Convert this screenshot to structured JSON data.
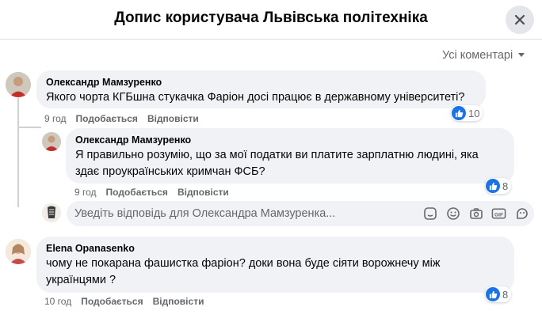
{
  "header": {
    "title": "Допис користувача Львівська політехніка"
  },
  "sort": {
    "label": "Усі коментарі"
  },
  "comments": [
    {
      "author": "Олександр Мамзуренко",
      "text": "Якого чорта КГБшна стукачка Фаріон досі працює в державному університеті?",
      "time": "9 год",
      "like": "Подобається",
      "reply": "Відповісти",
      "reactions": "10",
      "replies": [
        {
          "author": "Олександр Мамзуренко",
          "text": "Я правильно розумію, що за мої податки ви платите зарплатню людині, яка здає проукраїнських кримчан ФСБ?",
          "time": "9 год",
          "like": "Подобається",
          "reply": "Відповісти",
          "reactions": "8"
        }
      ],
      "reply_placeholder": "Уведіть відповідь для Олександра Мамзуренка..."
    },
    {
      "author": "Elena Opanasenko",
      "text": "чому не покарана фашистка фаріон? доки вона буде сіяти ворожнечу між українцями ?",
      "time": "10 год",
      "like": "Подобається",
      "reply": "Відповісти",
      "reactions": "8"
    }
  ],
  "colors": {
    "like_blue": "#1b74e4",
    "bubble_bg": "#f0f2f5",
    "muted_text": "#65676b"
  },
  "icons": [
    "close-icon",
    "chevron-down-icon",
    "like-icon",
    "sticker-icon",
    "emoji-icon",
    "camera-icon",
    "gif-icon",
    "sticker-face-icon"
  ]
}
